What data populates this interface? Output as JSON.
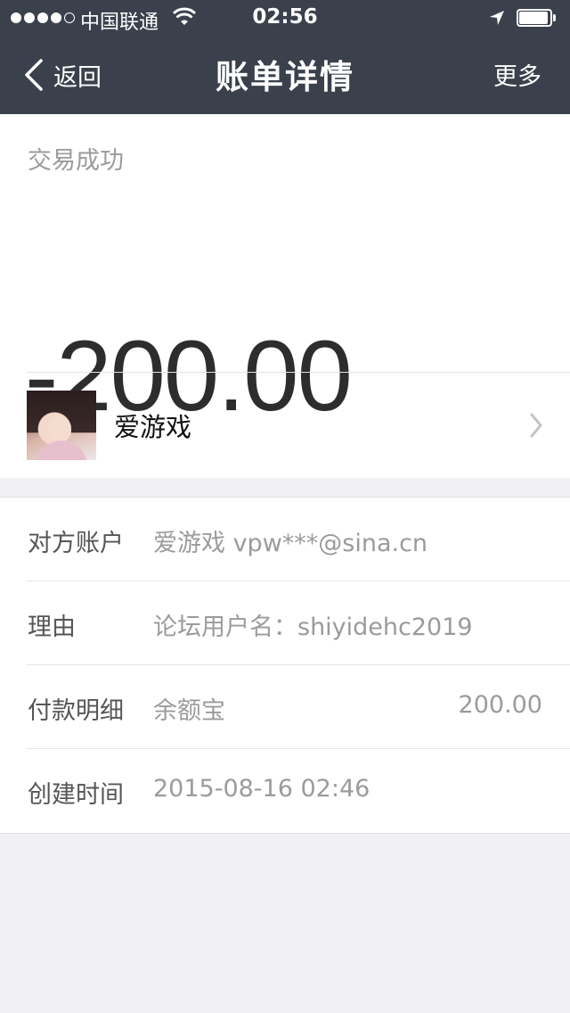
{
  "status_bar": {
    "carrier": "中国联通",
    "time": "02:56",
    "signal_bars": 4,
    "signal_total": 5,
    "battery_level": 0.95
  },
  "nav": {
    "back_label": "返回",
    "title": "账单详情",
    "more_label": "更多"
  },
  "summary": {
    "status": "交易成功",
    "amount": "-200.00"
  },
  "payee": {
    "name": "爱游戏"
  },
  "details": [
    {
      "label": "对方账户",
      "value": "爱游戏 vpw***@sina.cn",
      "right": ""
    },
    {
      "label": "理由",
      "value": "论坛用户名：shiyidehc2019",
      "right": ""
    },
    {
      "label": "付款明细",
      "value": "余额宝",
      "right": "200.00"
    },
    {
      "label": "创建时间",
      "value": "2015-08-16 02:46",
      "right": ""
    }
  ],
  "colors": {
    "nav_bg": "#3a414c",
    "page_bg": "#f0eff4",
    "muted_text": "#9b9b9b"
  }
}
